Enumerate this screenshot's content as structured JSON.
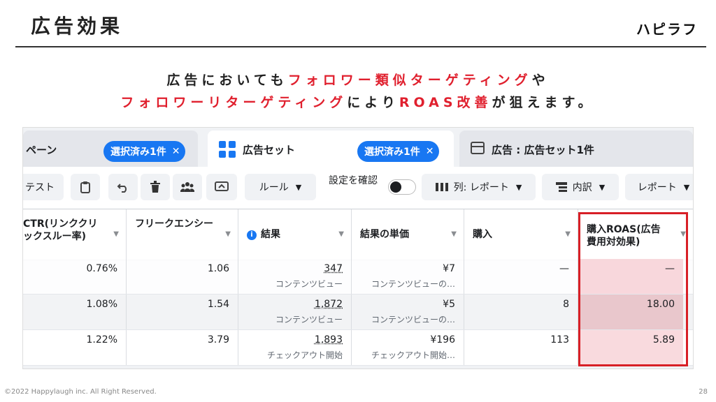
{
  "slide": {
    "title": "広告効果",
    "logo": "ハピラフ",
    "headline": {
      "line1_a": "広告においても",
      "line1_b": "フォロワー類似ターゲティング",
      "line1_c": "や",
      "line2_a": "フォロワーリターゲティング",
      "line2_b": "により",
      "line2_c": "ROAS改善",
      "line2_d": "が狙えます。"
    },
    "footer": "©2022 Happylaugh inc. All Right Reserved.",
    "page_number": "28"
  },
  "tabs": [
    {
      "label": "ペーン",
      "pill": "選択済み1件"
    },
    {
      "label": "広告セット",
      "pill": "選択済み1件",
      "icon": "grid-icon"
    },
    {
      "label": "広告 : 広告セット1件",
      "icon": "window-icon"
    }
  ],
  "pill_close": "✕",
  "toolbar": {
    "test_label": "テスト",
    "rules_label": "ルール",
    "settings_label": "設定を確認",
    "columns_label": "列: レポート",
    "breakdown_label": "内訳",
    "report_label": "レポート"
  },
  "table": {
    "headers": [
      "CTR(リンククリックスルー率)",
      "フリークエンシー",
      "結果",
      "結果の単価",
      "購入",
      "購入ROAS(広告費用対効果)"
    ],
    "rows": [
      {
        "ctr": "0.76%",
        "freq": "1.06",
        "result": "347",
        "result_sub": "コンテンツビュー",
        "cost": "¥7",
        "cost_sub": "コンテンツビューの…",
        "purchase": "—",
        "roas": "—"
      },
      {
        "ctr": "1.08%",
        "freq": "1.54",
        "result": "1,872",
        "result_sub": "コンテンツビュー",
        "cost": "¥5",
        "cost_sub": "コンテンツビューの…",
        "purchase": "8",
        "roas": "18.00"
      },
      {
        "ctr": "1.22%",
        "freq": "3.79",
        "result": "1,893",
        "result_sub": "チェックアウト開始",
        "cost": "¥196",
        "cost_sub": "チェックアウト開始…",
        "purchase": "113",
        "roas": "5.89"
      }
    ]
  },
  "colors": {
    "accent": "#1877f2",
    "highlight": "#e0202e",
    "roas_box": "#d81f26"
  }
}
